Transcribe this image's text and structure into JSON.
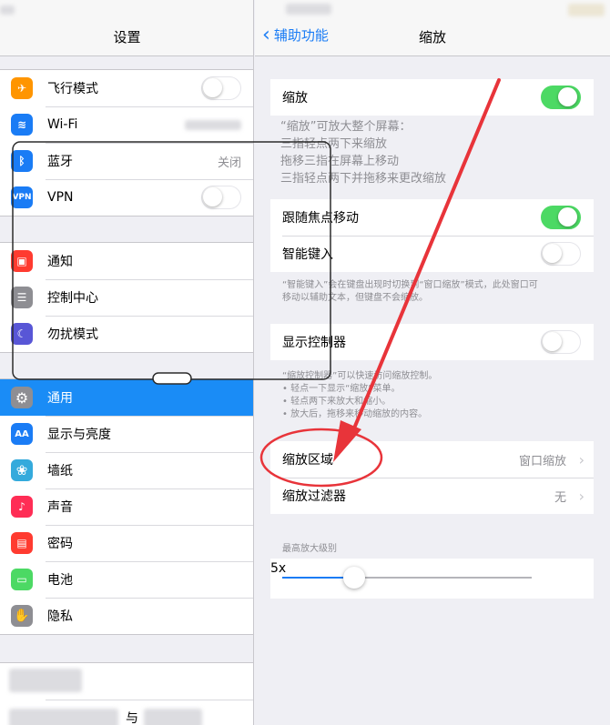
{
  "sidebar": {
    "title": "设置",
    "items": [
      {
        "label": "飞行模式",
        "icon": "airplane-icon",
        "color": "#ff9500",
        "glyph": "✈"
      },
      {
        "label": "Wi-Fi",
        "icon": "wifi-icon",
        "color": "#1a7cf5",
        "glyph": "≋"
      },
      {
        "label": "蓝牙",
        "icon": "bluetooth-icon",
        "color": "#1a7cf5",
        "value": "关闭",
        "glyph": "ᛒ"
      },
      {
        "label": "VPN",
        "icon": "vpn-icon",
        "color": "#1a7cf5",
        "glyph": "VPN"
      },
      {
        "label": "通知",
        "icon": "notifications-icon",
        "color": "#ff3b30",
        "glyph": "▣"
      },
      {
        "label": "控制中心",
        "icon": "control-center-icon",
        "color": "#8e8e93",
        "glyph": "☰"
      },
      {
        "label": "勿扰模式",
        "icon": "do-not-disturb-icon",
        "color": "#5856d6",
        "glyph": "☾"
      },
      {
        "label": "通用",
        "icon": "gear-icon",
        "color": "#8e8e93",
        "glyph": "⚙"
      },
      {
        "label": "显示与亮度",
        "icon": "display-icon",
        "color": "#1a7cf5",
        "glyph": "AA"
      },
      {
        "label": "墙纸",
        "icon": "wallpaper-icon",
        "color": "#34aadc",
        "glyph": "❀"
      },
      {
        "label": "声音",
        "icon": "sound-icon",
        "color": "#ff2d55",
        "glyph": "♪"
      },
      {
        "label": "密码",
        "icon": "passcode-icon",
        "color": "#ff3b30",
        "glyph": "🔒"
      },
      {
        "label": "电池",
        "icon": "battery-icon",
        "color": "#4cd964",
        "glyph": "▭"
      },
      {
        "label": "隐私",
        "icon": "privacy-hand-icon",
        "color": "#8e8e93",
        "glyph": "✋"
      }
    ],
    "partial_label": "与"
  },
  "detail": {
    "back_label": "辅助功能",
    "title": "缩放",
    "zoom_label": "缩放",
    "zoom_desc": "“缩放”可放大整个屏幕：\n三指轻点两下来缩放\n拖移三指在屏幕上移动\n三指轻点两下并拖移来更改缩放",
    "follow_focus_label": "跟随焦点移动",
    "smart_typing_label": "智能键入",
    "smart_typing_desc": "“智能键入”会在键盘出现时切换到“窗口缩放”模式，此处窗口可\n移动以辅助文本，但键盘不会缩放。",
    "show_controller_label": "显示控制器",
    "controller_desc": "“缩放控制器”可以快速访问缩放控制。\n• 轻点一下显示“缩放”菜单。\n• 轻点两下来放大和缩小。\n• 放大后，拖移来移动缩放的内容。",
    "zoom_region_label": "缩放区域",
    "zoom_region_value": "窗口缩放",
    "zoom_filter_label": "缩放过滤器",
    "zoom_filter_value": "无",
    "max_zoom_header": "最高放大级别",
    "max_zoom_value": "5x",
    "max_zoom_fraction": 0.29
  },
  "colors": {
    "accent": "#1a7cf5",
    "switch_on": "#4cd964",
    "annotation": "#e8343a"
  }
}
